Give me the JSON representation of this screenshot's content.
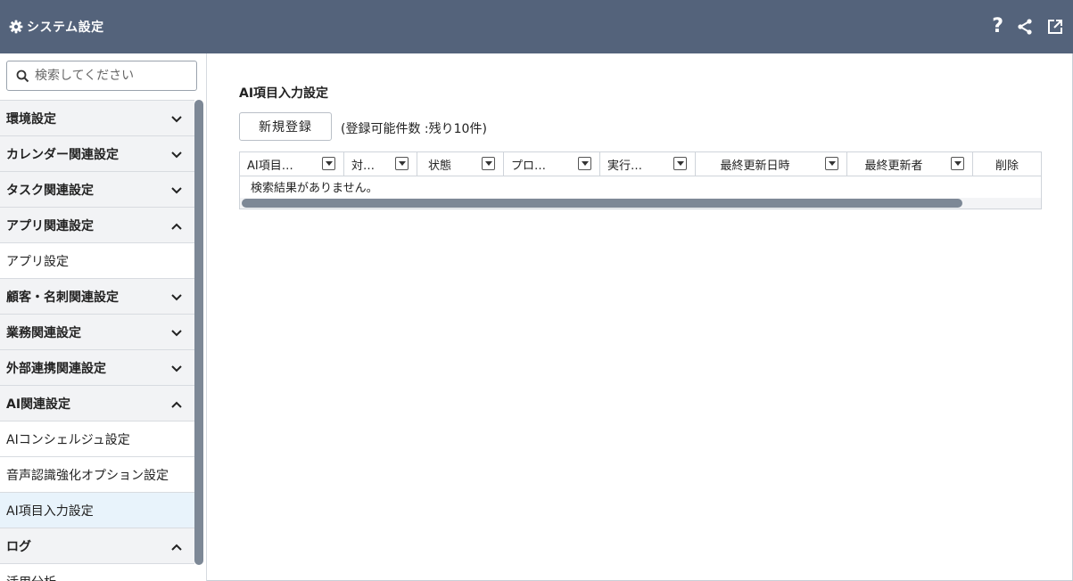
{
  "header": {
    "title": "システム設定",
    "icons": [
      "gear-icon",
      "help-icon",
      "share-icon",
      "open-external-icon"
    ],
    "help_label": "?"
  },
  "sidebar": {
    "search_placeholder": "検索してください",
    "items": [
      {
        "type": "category",
        "label": "環境設定",
        "chevron": "down"
      },
      {
        "type": "category",
        "label": "カレンダー関連設定",
        "chevron": "down"
      },
      {
        "type": "category",
        "label": "タスク関連設定",
        "chevron": "down"
      },
      {
        "type": "category",
        "label": "アプリ関連設定",
        "chevron": "up"
      },
      {
        "type": "item",
        "label": "アプリ設定"
      },
      {
        "type": "category",
        "label": "顧客・名刺関連設定",
        "chevron": "down"
      },
      {
        "type": "category",
        "label": "業務関連設定",
        "chevron": "down"
      },
      {
        "type": "category",
        "label": "外部連携関連設定",
        "chevron": "down"
      },
      {
        "type": "category",
        "label": "AI関連設定",
        "chevron": "up"
      },
      {
        "type": "item",
        "label": "AIコンシェルジュ設定"
      },
      {
        "type": "item",
        "label": "音声認識強化オプション設定"
      },
      {
        "type": "item",
        "label": "AI項目入力設定",
        "active": true
      },
      {
        "type": "category",
        "label": "ログ",
        "chevron": "up"
      },
      {
        "type": "item",
        "label": "活用分析"
      }
    ]
  },
  "main": {
    "page_title": "AI項目入力設定",
    "new_button_label": "新規登録",
    "quota_text": "(登録可能件数 :残り10件)",
    "table": {
      "columns": [
        "AI項目…",
        "対…",
        "状態",
        "プロ…",
        "実行…",
        "最終更新日時",
        "最終更新者",
        "削除"
      ],
      "empty_message": "検索結果がありません。"
    }
  },
  "colors": {
    "header_bg": "#54637b",
    "active_item_bg": "#e8f3fb",
    "scrollbar_thumb": "#7d8896"
  }
}
